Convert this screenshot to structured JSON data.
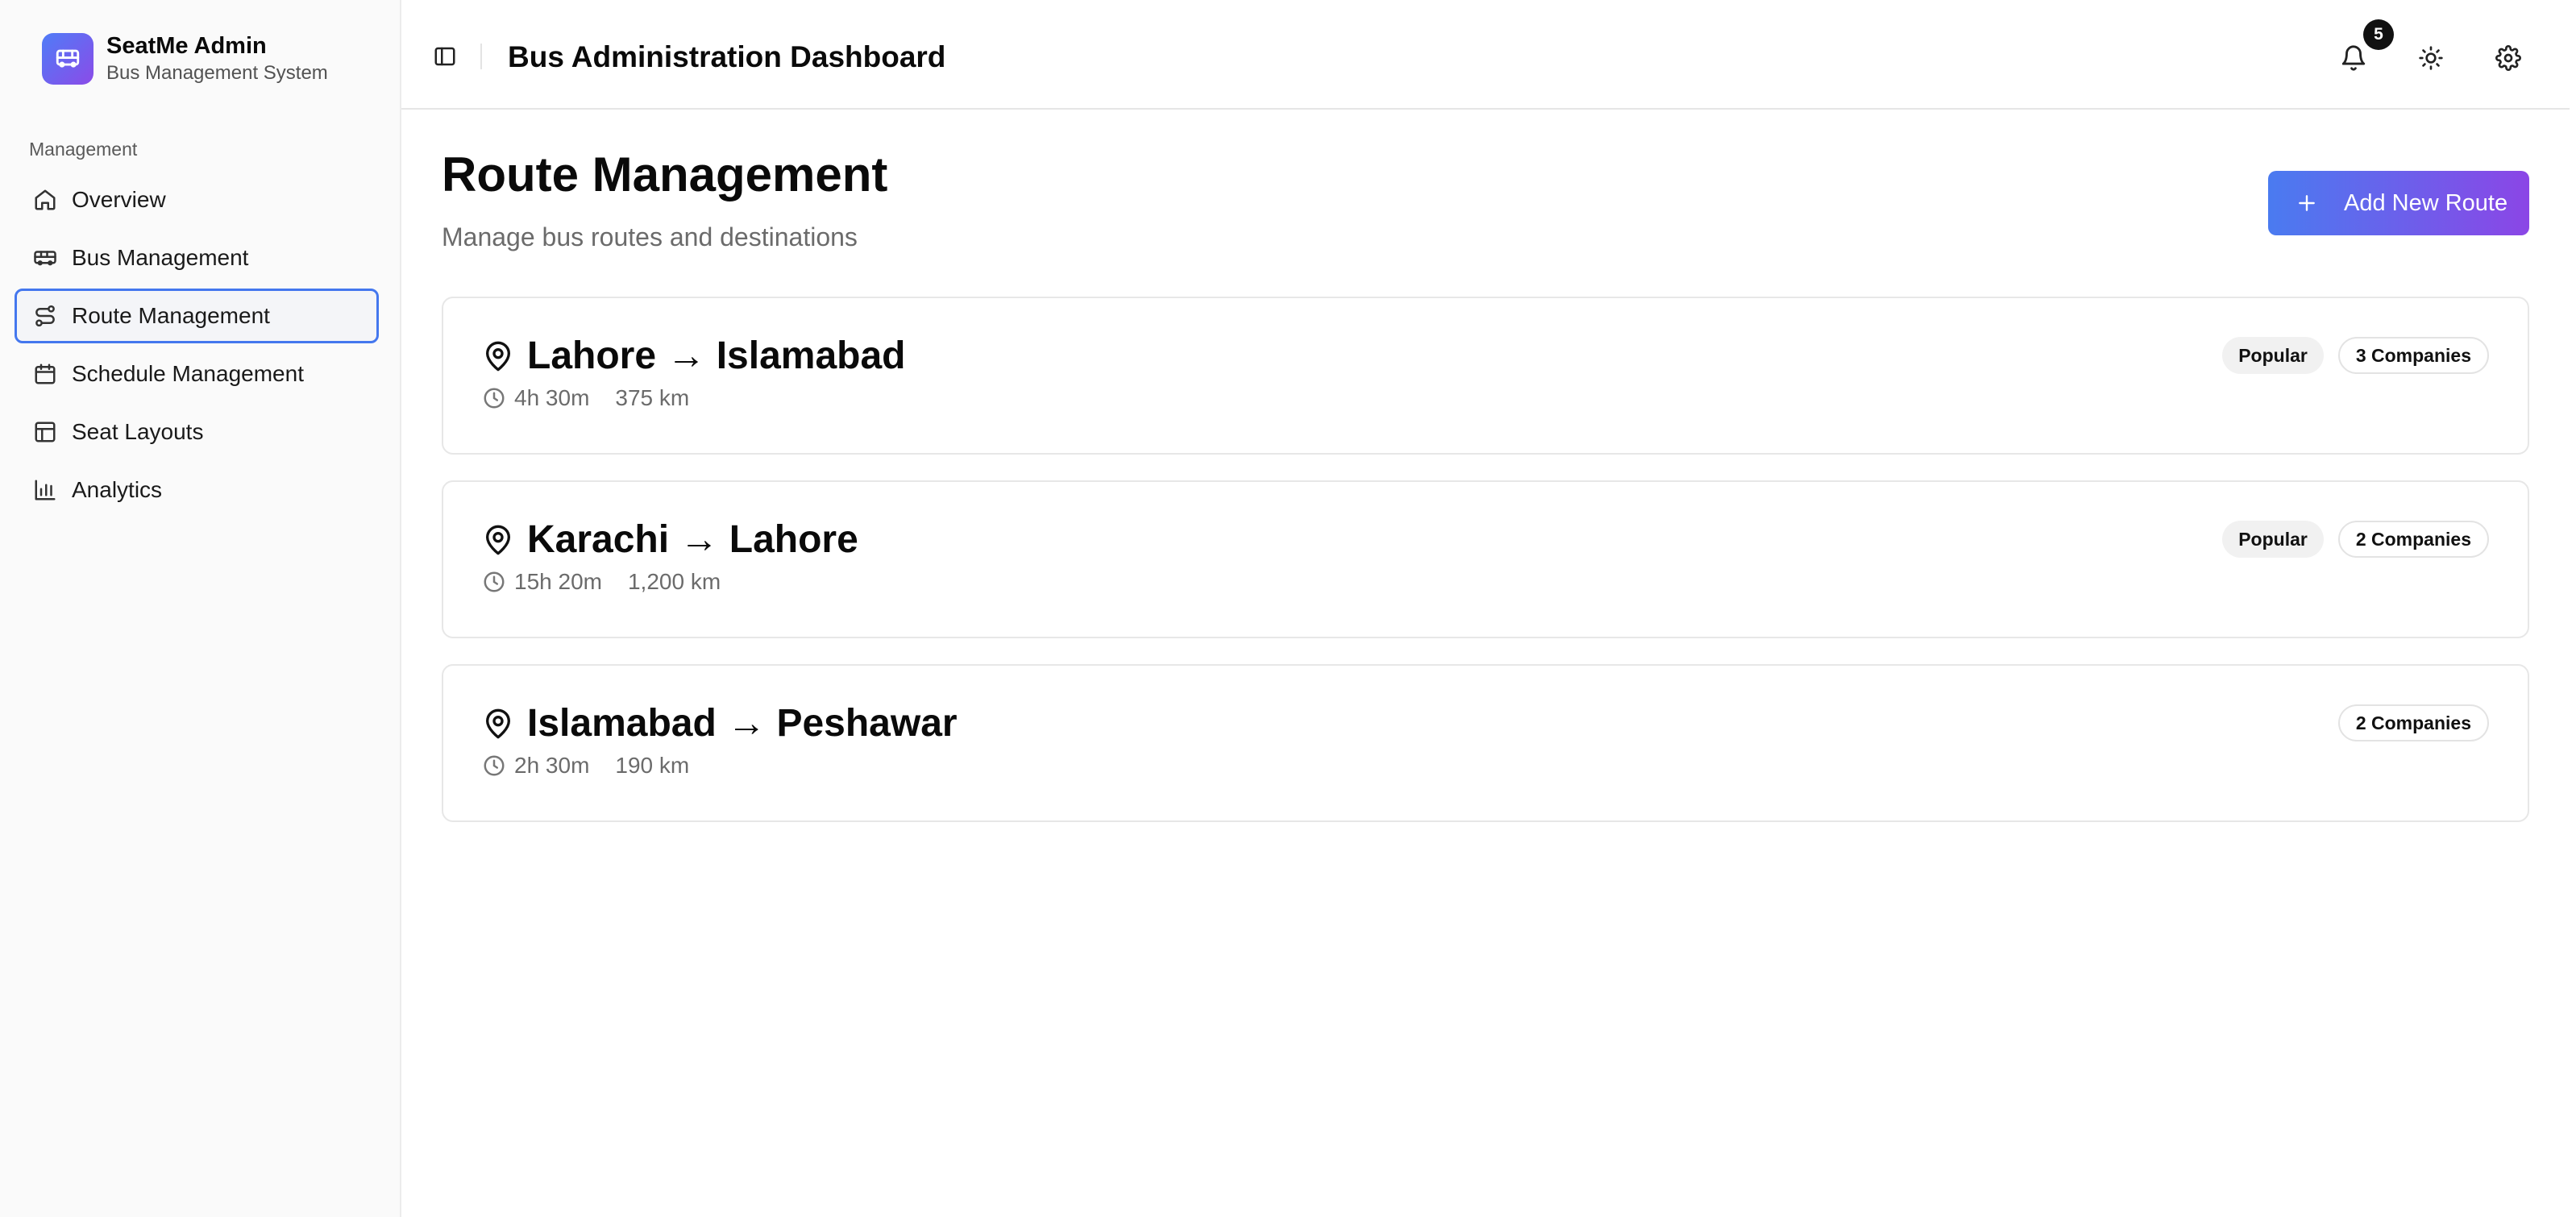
{
  "brand": {
    "name": "SeatMe Admin",
    "subtitle": "Bus Management System",
    "logo_icon": "bus-icon"
  },
  "sidebar": {
    "group_label": "Management",
    "items": [
      {
        "label": "Overview",
        "icon": "home-icon"
      },
      {
        "label": "Bus Management",
        "icon": "bus-icon"
      },
      {
        "label": "Route Management",
        "icon": "route-icon",
        "active": true
      },
      {
        "label": "Schedule Management",
        "icon": "calendar-icon"
      },
      {
        "label": "Seat Layouts",
        "icon": "layout-icon"
      },
      {
        "label": "Analytics",
        "icon": "bar-chart-icon"
      }
    ]
  },
  "header": {
    "title": "Bus Administration Dashboard",
    "notification_count": "5",
    "icons": [
      "sidebar-toggle-icon",
      "bell-icon",
      "sun-icon",
      "gear-icon"
    ]
  },
  "main": {
    "title": "Route Management",
    "subtitle": "Manage bus routes and destinations",
    "add_button_label": "Add New Route",
    "routes": [
      {
        "name": "Lahore → Islamabad",
        "duration": "4h 30m",
        "distance": "375 km",
        "popular": "Popular",
        "companies": "3 Companies"
      },
      {
        "name": "Karachi → Lahore",
        "duration": "15h 20m",
        "distance": "1,200 km",
        "popular": "Popular",
        "companies": "2 Companies"
      },
      {
        "name": "Islamabad → Peshawar",
        "duration": "2h 30m",
        "distance": "190 km",
        "popular": "",
        "companies": "2 Companies"
      }
    ]
  },
  "colors": {
    "accent_start": "#4a7bf0",
    "accent_end": "#8b46e6",
    "active_border": "#4477ee"
  }
}
